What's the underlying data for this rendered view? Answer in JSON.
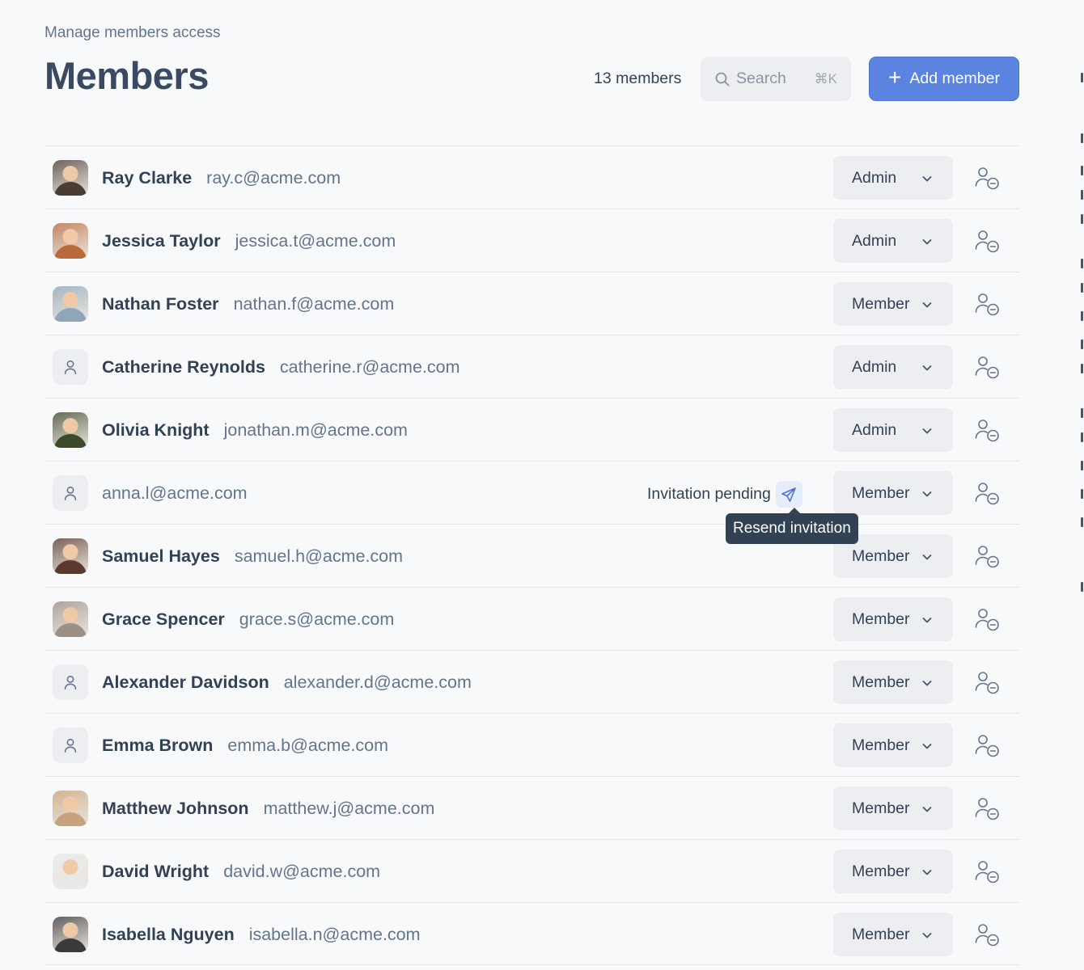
{
  "header": {
    "subtitle": "Manage members access",
    "title": "Members",
    "count_label": "13 members",
    "search_placeholder": "Search",
    "search_shortcut": "⌘K",
    "add_button_label": "Add member"
  },
  "tooltip": {
    "label": "Resend invitation"
  },
  "colors": {
    "accent": "#5b84e0",
    "background": "#f8f9fb",
    "tooltip": "#334155"
  },
  "members": [
    {
      "name": "Ray Clarke",
      "email": "ray.c@acme.com",
      "role": "Admin",
      "avatar": "photo"
    },
    {
      "name": "Jessica Taylor",
      "email": "jessica.t@acme.com",
      "role": "Admin",
      "avatar": "photo"
    },
    {
      "name": "Nathan Foster",
      "email": "nathan.f@acme.com",
      "role": "Member",
      "avatar": "photo"
    },
    {
      "name": "Catherine Reynolds",
      "email": "catherine.r@acme.com",
      "role": "Admin",
      "avatar": "placeholder"
    },
    {
      "name": "Olivia Knight",
      "email": "jonathan.m@acme.com",
      "role": "Admin",
      "avatar": "photo"
    },
    {
      "name": "",
      "email": "anna.l@acme.com",
      "role": "Member",
      "avatar": "placeholder",
      "status": "Invitation pending"
    },
    {
      "name": "Samuel Hayes",
      "email": "samuel.h@acme.com",
      "role": "Member",
      "avatar": "photo"
    },
    {
      "name": "Grace Spencer",
      "email": "grace.s@acme.com",
      "role": "Member",
      "avatar": "photo"
    },
    {
      "name": "Alexander Davidson",
      "email": "alexander.d@acme.com",
      "role": "Member",
      "avatar": "placeholder"
    },
    {
      "name": "Emma Brown",
      "email": "emma.b@acme.com",
      "role": "Member",
      "avatar": "placeholder"
    },
    {
      "name": "Matthew Johnson",
      "email": "matthew.j@acme.com",
      "role": "Member",
      "avatar": "photo"
    },
    {
      "name": "David Wright",
      "email": "david.w@acme.com",
      "role": "Member",
      "avatar": "photo"
    },
    {
      "name": "Isabella Nguyen",
      "email": "isabella.n@acme.com",
      "role": "Member",
      "avatar": "photo"
    }
  ]
}
